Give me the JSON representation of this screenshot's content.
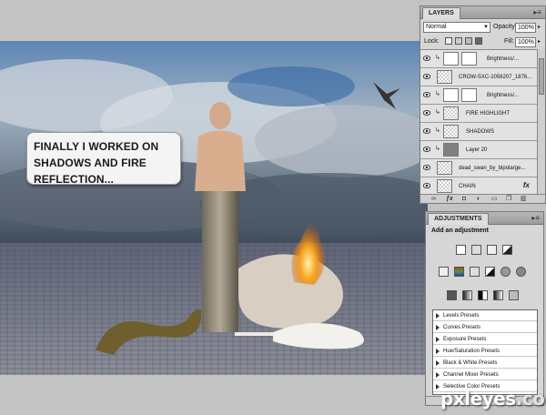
{
  "canvas": {
    "callout_line1": "FINALLY I WORKED ON",
    "callout_line2": "SHADOWS AND FIRE",
    "callout_line3": "REFLECTION..."
  },
  "layers_panel": {
    "tab": "LAYERS",
    "blend_mode": "Normal",
    "opacity_label": "Opacity:",
    "opacity_value": "100%",
    "lock_label": "Lock:",
    "fill_label": "Fill:",
    "fill_value": "100%",
    "layers": [
      {
        "name": "Brightness/...",
        "type": "adjustment"
      },
      {
        "name": "CROW-SXC-1056207_1876...",
        "type": "pixel"
      },
      {
        "name": "Brightness/...",
        "type": "adjustment"
      },
      {
        "name": "FIRE HIGHLIGHT",
        "type": "pixel"
      },
      {
        "name": "SHADOWS",
        "type": "pixel"
      },
      {
        "name": "Layer 20",
        "type": "gray"
      },
      {
        "name": "dead_swan_by_bipolarge...",
        "type": "pixel"
      },
      {
        "name": "CHAIN",
        "type": "pixel",
        "fx": "fx"
      }
    ]
  },
  "adjustments_panel": {
    "tab": "ADJUSTMENTS",
    "title": "Add an adjustment",
    "presets": [
      "Levels Presets",
      "Curves Presets",
      "Exposure Presets",
      "Hue/Saturation Presets",
      "Black & White Presets",
      "Channel Mixer Presets",
      "Selective Color Presets"
    ]
  },
  "watermark": {
    "text": "pxleyes",
    "suffix": ".com"
  },
  "colors": {
    "panel_bg": "#d6d6d6",
    "sky_blue": "#3f6fa0",
    "fire": "#f29a1c"
  }
}
